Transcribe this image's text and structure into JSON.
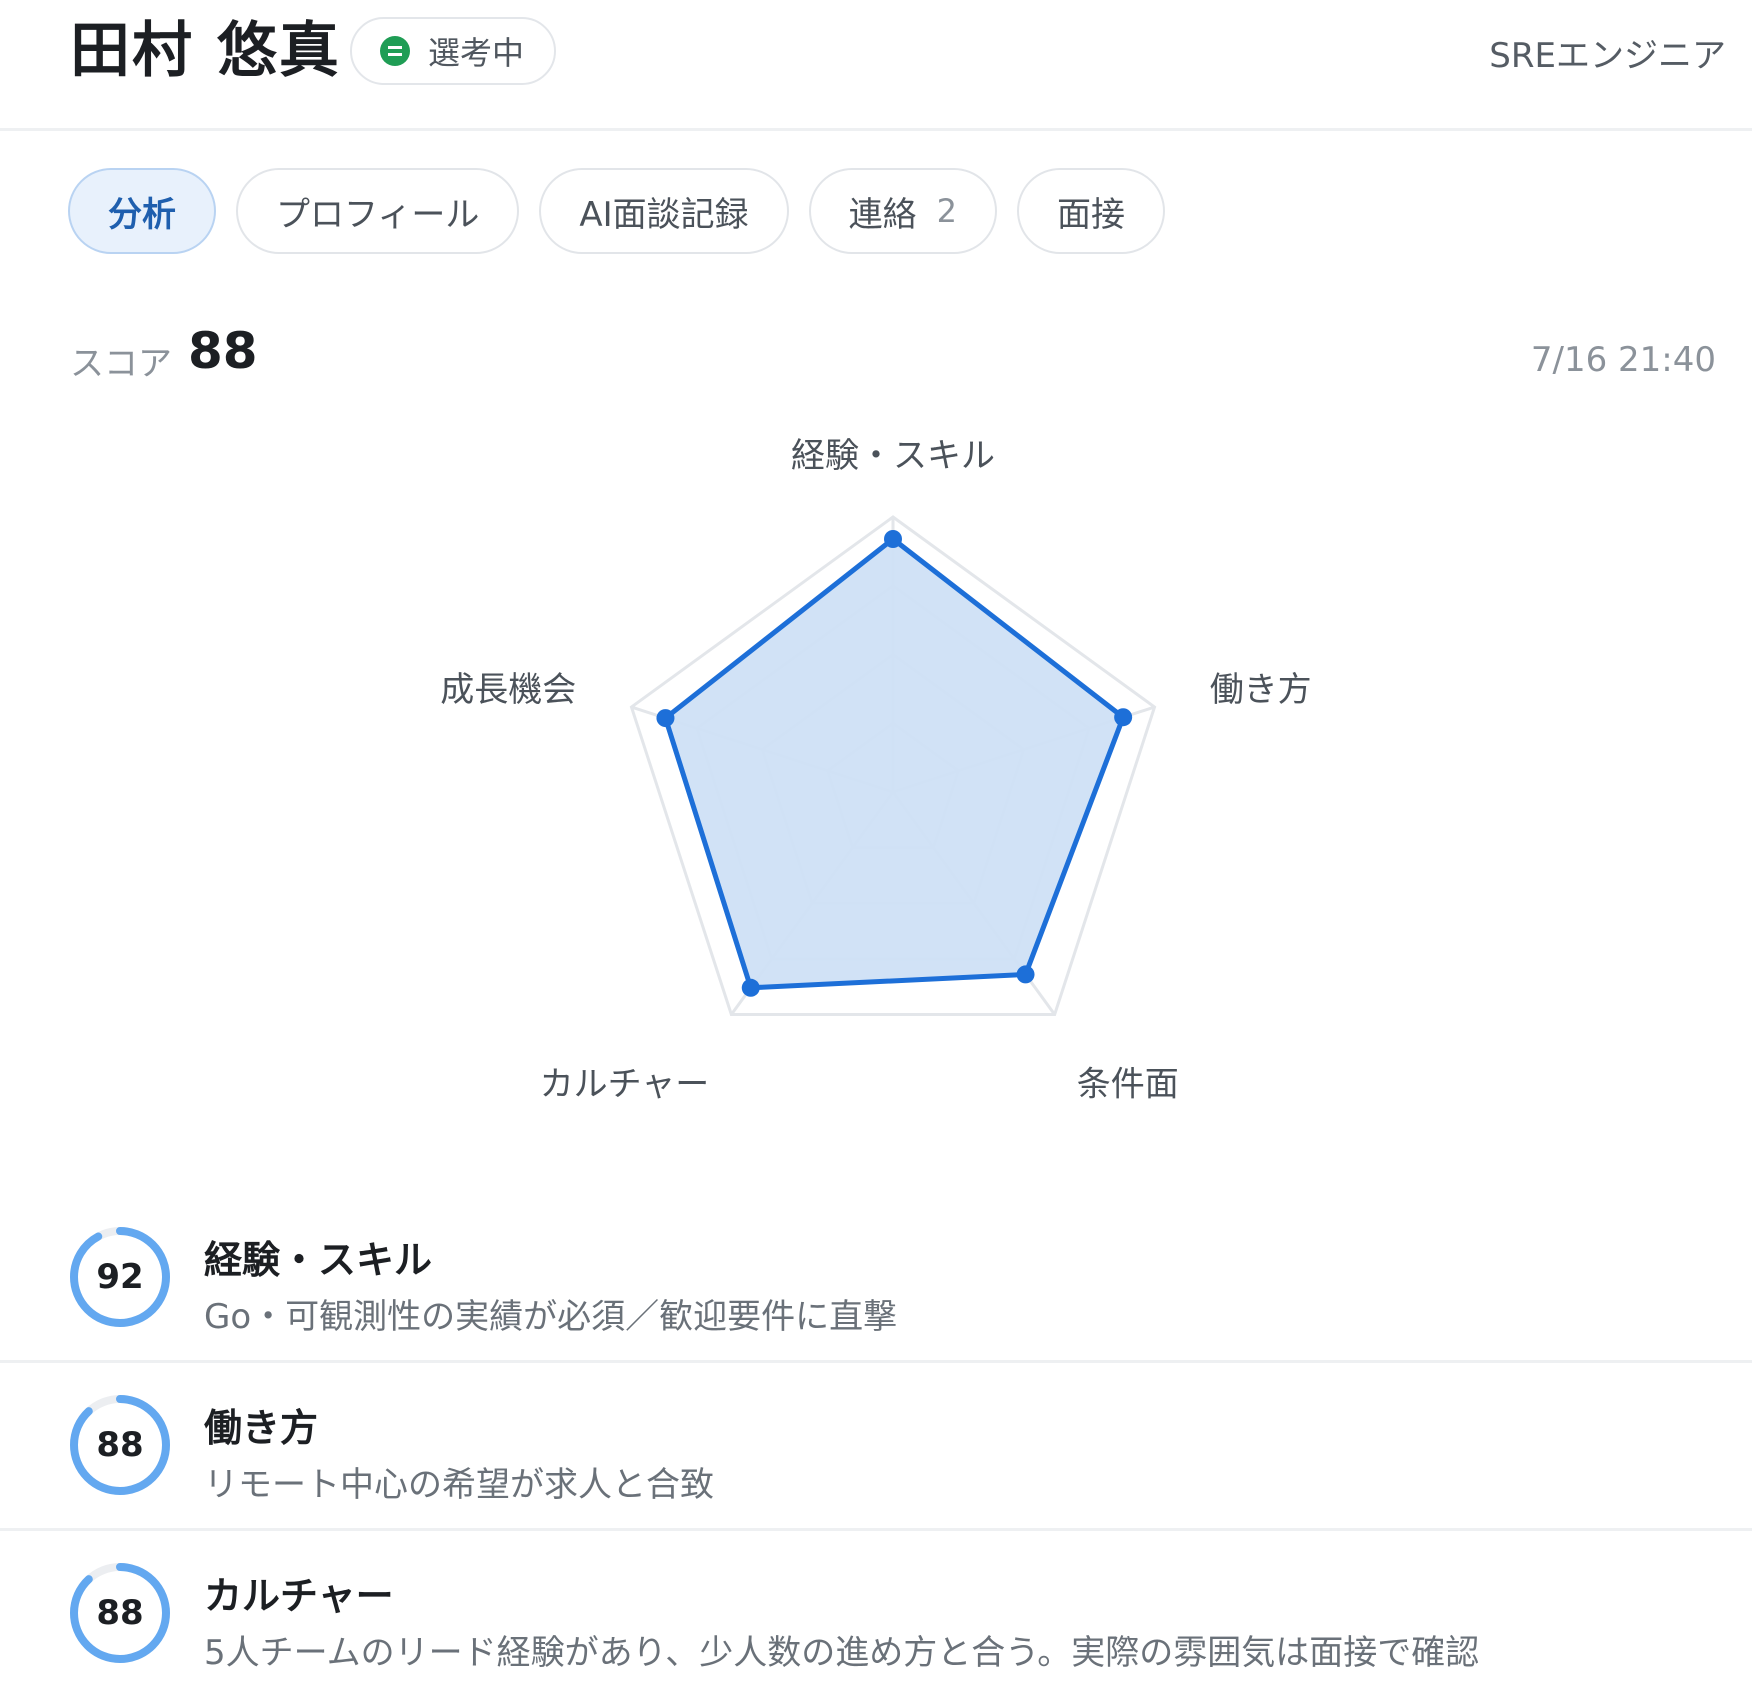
{
  "candidate": {
    "name": "田村 悠真",
    "status": "選考中",
    "job_title": "SREエンジニア"
  },
  "tabs": [
    {
      "label": "分析",
      "active": true
    },
    {
      "label": "プロフィール"
    },
    {
      "label": "AI面談記録"
    },
    {
      "label": "連絡",
      "count": "2"
    },
    {
      "label": "面接"
    }
  ],
  "score": {
    "label": "スコア",
    "value": "88",
    "timestamp": "7/16 21:40"
  },
  "chart_data": {
    "type": "radar",
    "axes": [
      "経験・スキル",
      "働き方",
      "条件面",
      "カルチャー",
      "成長機会"
    ],
    "values": [
      92,
      88,
      82,
      88,
      87
    ],
    "range": [
      0,
      100
    ],
    "grid_levels": 4,
    "grid": true,
    "colors": {
      "line": "#1d6fd8",
      "fill": "#cfe0f6",
      "grid": "#e3e6ea"
    }
  },
  "details": [
    {
      "score": "92",
      "percent": 92,
      "title": "経験・スキル",
      "description": "Go・可観測性の実績が必須／歓迎要件に直撃"
    },
    {
      "score": "88",
      "percent": 88,
      "title": "働き方",
      "description": "リモート中心の希望が求人と合致"
    },
    {
      "score": "88",
      "percent": 88,
      "title": "カルチャー",
      "description": "5人チームのリード経験があり、少人数の進め方と合う。実際の雰囲気は面接で確認"
    }
  ],
  "colors": {
    "accent": "#1d6fd8",
    "status_green": "#1f9d55",
    "ring": "#63a8f0",
    "ring_track": "#eceef1"
  }
}
